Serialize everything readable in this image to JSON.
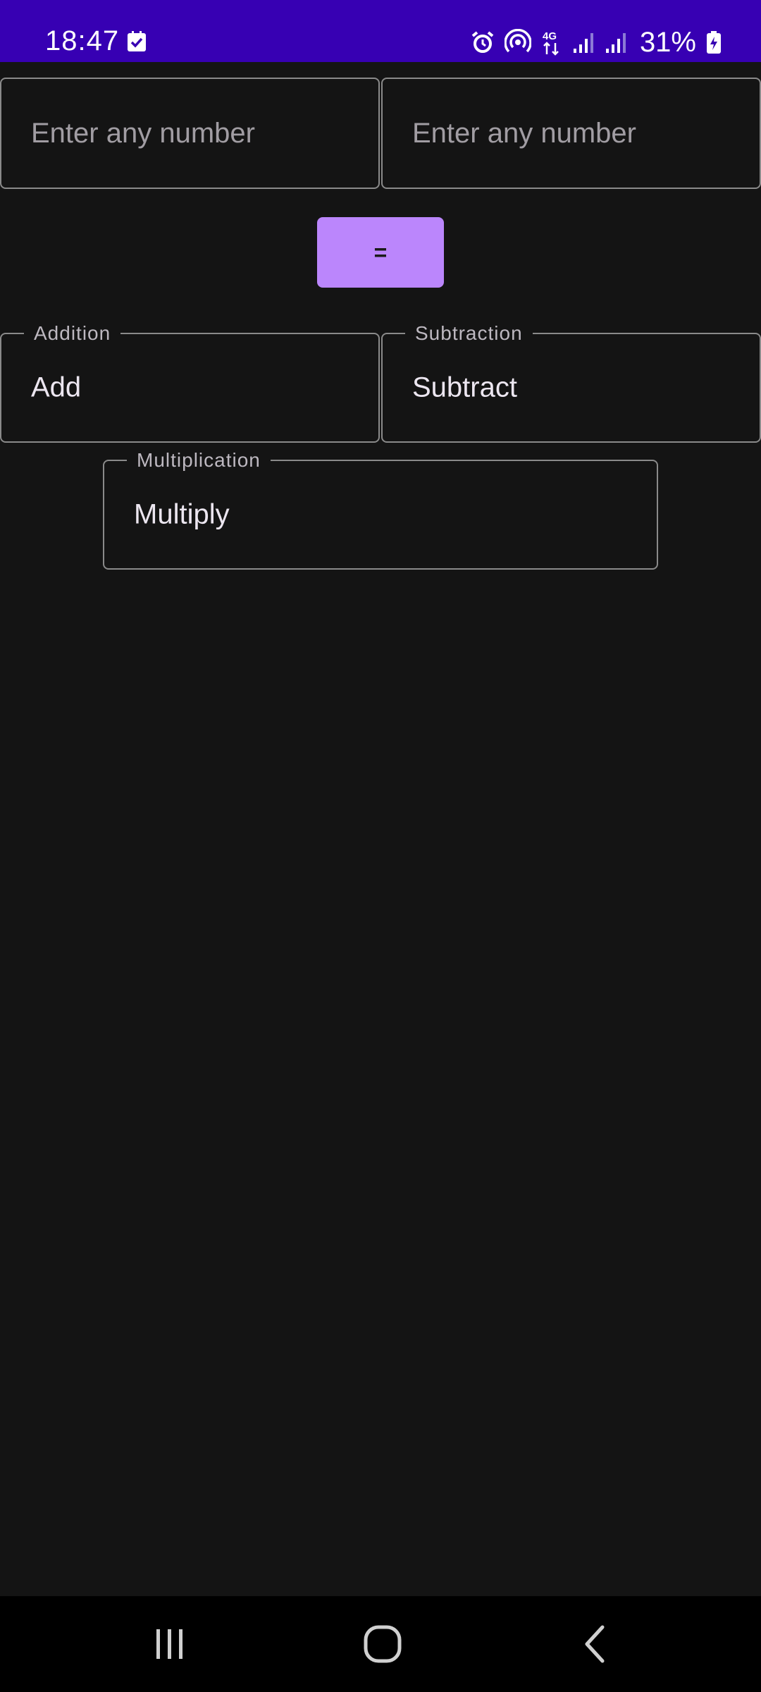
{
  "status_bar": {
    "time": "18:47",
    "battery": "31%",
    "background": "#3700b3",
    "icons": [
      "checkbox-notification-icon",
      "alarm-icon",
      "hotspot-icon",
      "4g-data-icon",
      "signal-icon",
      "signal-icon",
      "battery-charging-icon"
    ]
  },
  "inputs": {
    "first_placeholder": "Enter any number",
    "second_placeholder": "Enter any number"
  },
  "equals_button": {
    "label": "=",
    "color": "#bb86fc"
  },
  "results": {
    "addition": {
      "label": "Addition",
      "value": "Add"
    },
    "subtraction": {
      "label": "Subtraction",
      "value": "Subtract"
    },
    "multiplication": {
      "label": "Multiplication",
      "value": "Multiply"
    }
  },
  "nav_bar": {
    "icons": [
      "recents-icon",
      "home-icon",
      "back-icon"
    ]
  }
}
